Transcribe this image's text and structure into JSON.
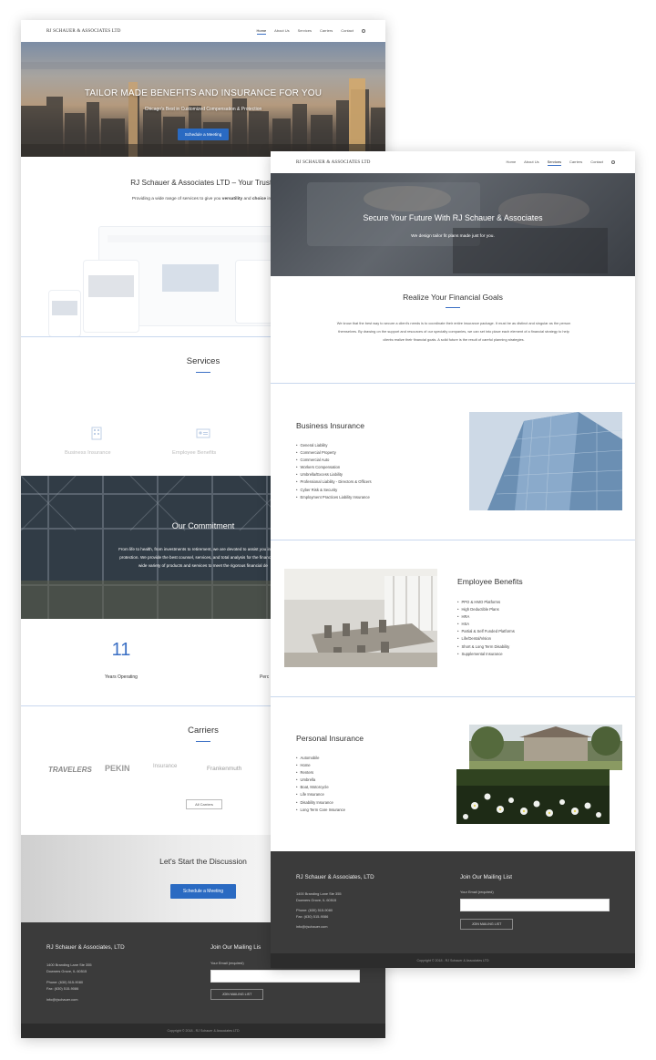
{
  "nav": {
    "brand": "RJ SCHAUER & ASSOCIATES LTD",
    "items": [
      "Home",
      "About Us",
      "Services",
      "Carriers",
      "Contact"
    ]
  },
  "back": {
    "hero_title": "TAILOR MADE BENEFITS AND INSURANCE FOR YOU",
    "hero_subtitle": "Chicago's Best in Customized Compensation & Protection",
    "hero_button": "Schedule a Meeting",
    "intro_title": "RJ Schauer & Associates LTD – Your Truste",
    "intro_text_pre": "Providing a wide range of services to give you ",
    "intro_text_b1": "versatility",
    "intro_text_mid": " and ",
    "intro_text_b2": "choice",
    "intro_text_post": " in o",
    "services_title": "Services",
    "services": [
      "Business Insurance",
      "Employee Benefits"
    ],
    "commitment_title": "Our Commitment",
    "commitment_text": [
      "From life to health, from investments to retirement, we are devoted to assist you in your fina",
      "protection. We provide the best counsel, services, and total analysis for the financial future",
      "wide variety of products and services to meet the rigorous financial de"
    ],
    "stat_value": "11",
    "stat_label": "Years Operating",
    "stat_label_2": "Perc",
    "carriers_title": "Carriers",
    "carriers": [
      "TRAVELERS",
      "PEKIN",
      "Insurance",
      "Frankenmuth"
    ],
    "carriers_button": "All Carriers",
    "cta_title": "Let's Start the Discussion",
    "cta_button": "Schedule a Meeting",
    "footer_company": "RJ Schauer & Associates, LTD",
    "footer_join": "Join Our Mailing Lis",
    "footer_address": [
      "1400 Branding Lane Ste 355",
      "Downers Grove, IL 60515"
    ],
    "footer_phone": "Phone: (630) 515-9080",
    "footer_fax": "Fax: (630) 515-9086",
    "footer_email": "info@rjschauer.com",
    "footer_email_label": "Your Email (required)",
    "footer_join_button": "JOIN MAILING LIST",
    "copyright": "Copyright © 2018 - RJ Schauer & Associates LTD"
  },
  "front": {
    "hero_title": "Secure Your Future With RJ Schauer & Associates",
    "hero_subtitle": "We design tailor fit plans made just for you.",
    "goals_title": "Realize Your Financial Goals",
    "goals_text": [
      "We know that the best way to secure a client's needs is to coordinate their entire insurance package. It must be as distinct and singular as the person",
      "themselves. By drawing on the support and resources of our specialty companies, we can set into place each element of a financial strategy to help",
      "clients realize their financial goals. A solid future is the result of careful planning strategies."
    ],
    "business_title": "Business Insurance",
    "business_items": [
      "General Liability",
      "Commercial Property",
      "Commercial Auto",
      "Workers Compensation",
      "Umbrella/Excess Liability",
      "Professional Liability - Directors & Officers",
      "Cyber Risk & Security",
      "Employment Practices Liability Insurance"
    ],
    "benefits_title": "Employee Benefits",
    "benefits_items": [
      "PPO & HMO Platforms",
      "High Deductible Plans",
      "HRA",
      "HSA",
      "Partial & Self Funded Platforms",
      "Life/Dental/Vision",
      "Short & Long Term Disability",
      "Supplemental Insurance"
    ],
    "personal_title": "Personal Insurance",
    "personal_items": [
      "Automobile",
      "Home",
      "Renters",
      "Umbrella",
      "Boat, Motorcycle",
      "Life Insurance",
      "Disability Insurance",
      "Long Term Care Insurance"
    ],
    "footer_company": "RJ Schauer & Associates, LTD",
    "footer_join": "Join Our Mailing List",
    "footer_address": [
      "1400 Branding Lane Ste 355",
      "Downers Grove, IL 60515"
    ],
    "footer_phone": "Phone: (630) 515-9080",
    "footer_fax": "Fax: (630) 515-9086",
    "footer_email": "info@rjschauer.com",
    "footer_email_label": "Your Email (required)",
    "footer_join_button": "JOIN MAILING LIST",
    "copyright": "Copyright © 2018 - RJ Schauer & Associates LTD"
  },
  "colors": {
    "accent": "#2a6ac2",
    "footer": "#3b3b3b",
    "divider": "#c9d8ee"
  },
  "icons": [
    "search-icon",
    "building-icon",
    "id-card-icon"
  ]
}
